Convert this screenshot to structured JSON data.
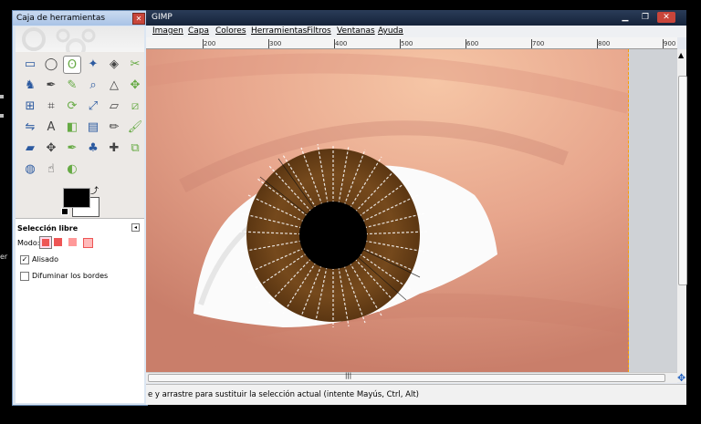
{
  "desktop": {
    "left_text": "er"
  },
  "toolbox": {
    "title": "Caja de herramientas",
    "close_glyph": "✕",
    "tools": [
      {
        "name": "rect-select-tool-icon"
      },
      {
        "name": "ellipse-select-tool-icon"
      },
      {
        "name": "free-select-tool-icon",
        "selected": true
      },
      {
        "name": "fuzzy-select-tool-icon"
      },
      {
        "name": "select-by-color-tool-icon"
      },
      {
        "name": "scissors-select-tool-icon"
      },
      {
        "name": "foreground-select-tool-icon"
      },
      {
        "name": "paths-tool-icon"
      },
      {
        "name": "color-picker-tool-icon"
      },
      {
        "name": "zoom-tool-icon"
      },
      {
        "name": "measure-tool-icon"
      },
      {
        "name": "move-tool-icon"
      },
      {
        "name": "align-tool-icon"
      },
      {
        "name": "crop-tool-icon"
      },
      {
        "name": "rotate-tool-icon"
      },
      {
        "name": "scale-tool-icon"
      },
      {
        "name": "shear-tool-icon"
      },
      {
        "name": "perspective-tool-icon"
      },
      {
        "name": "flip-tool-icon"
      },
      {
        "name": "text-tool-icon"
      },
      {
        "name": "bucket-fill-tool-icon"
      },
      {
        "name": "blend-tool-icon"
      },
      {
        "name": "pencil-tool-icon"
      },
      {
        "name": "paintbrush-tool-icon"
      },
      {
        "name": "eraser-tool-icon"
      },
      {
        "name": "airbrush-tool-icon"
      },
      {
        "name": "ink-tool-icon"
      },
      {
        "name": "clone-tool-icon"
      },
      {
        "name": "heal-tool-icon"
      },
      {
        "name": "perspective-clone-tool-icon"
      },
      {
        "name": "blur-sharpen-tool-icon"
      },
      {
        "name": "smudge-tool-icon"
      },
      {
        "name": "dodge-burn-tool-icon"
      }
    ],
    "colors": {
      "foreground": "#000000",
      "background": "#ffffff"
    },
    "options": {
      "title": "Selección libre",
      "mode_label": "Modo:",
      "antialias_label": "Alisado",
      "antialias_checked_glyph": "✓",
      "feather_label": "Difuminar los bordes"
    }
  },
  "gimp": {
    "title": "GIMP",
    "window_buttons": {
      "minimize": "▁",
      "maximize": "❐",
      "close": "✕"
    },
    "menu": [
      "Imagen",
      "Capa",
      "Colores",
      "Herramientas",
      "Filtros",
      "Ventanas",
      "Ayuda"
    ],
    "ruler_labels": [
      "200",
      "300",
      "400",
      "500",
      "600",
      "700",
      "800",
      "900"
    ],
    "status_text": "e y arrastre para sustituir la selección actual (intente Mayús, Ctrl, Alt)",
    "scroll_glyph": "|||",
    "nav_glyph": "✥"
  },
  "colors": {
    "skin": "#e6a58e",
    "iris": "#714619",
    "pupil": "#000000",
    "sclera": "#ffffff",
    "accent": "#f8a000"
  }
}
